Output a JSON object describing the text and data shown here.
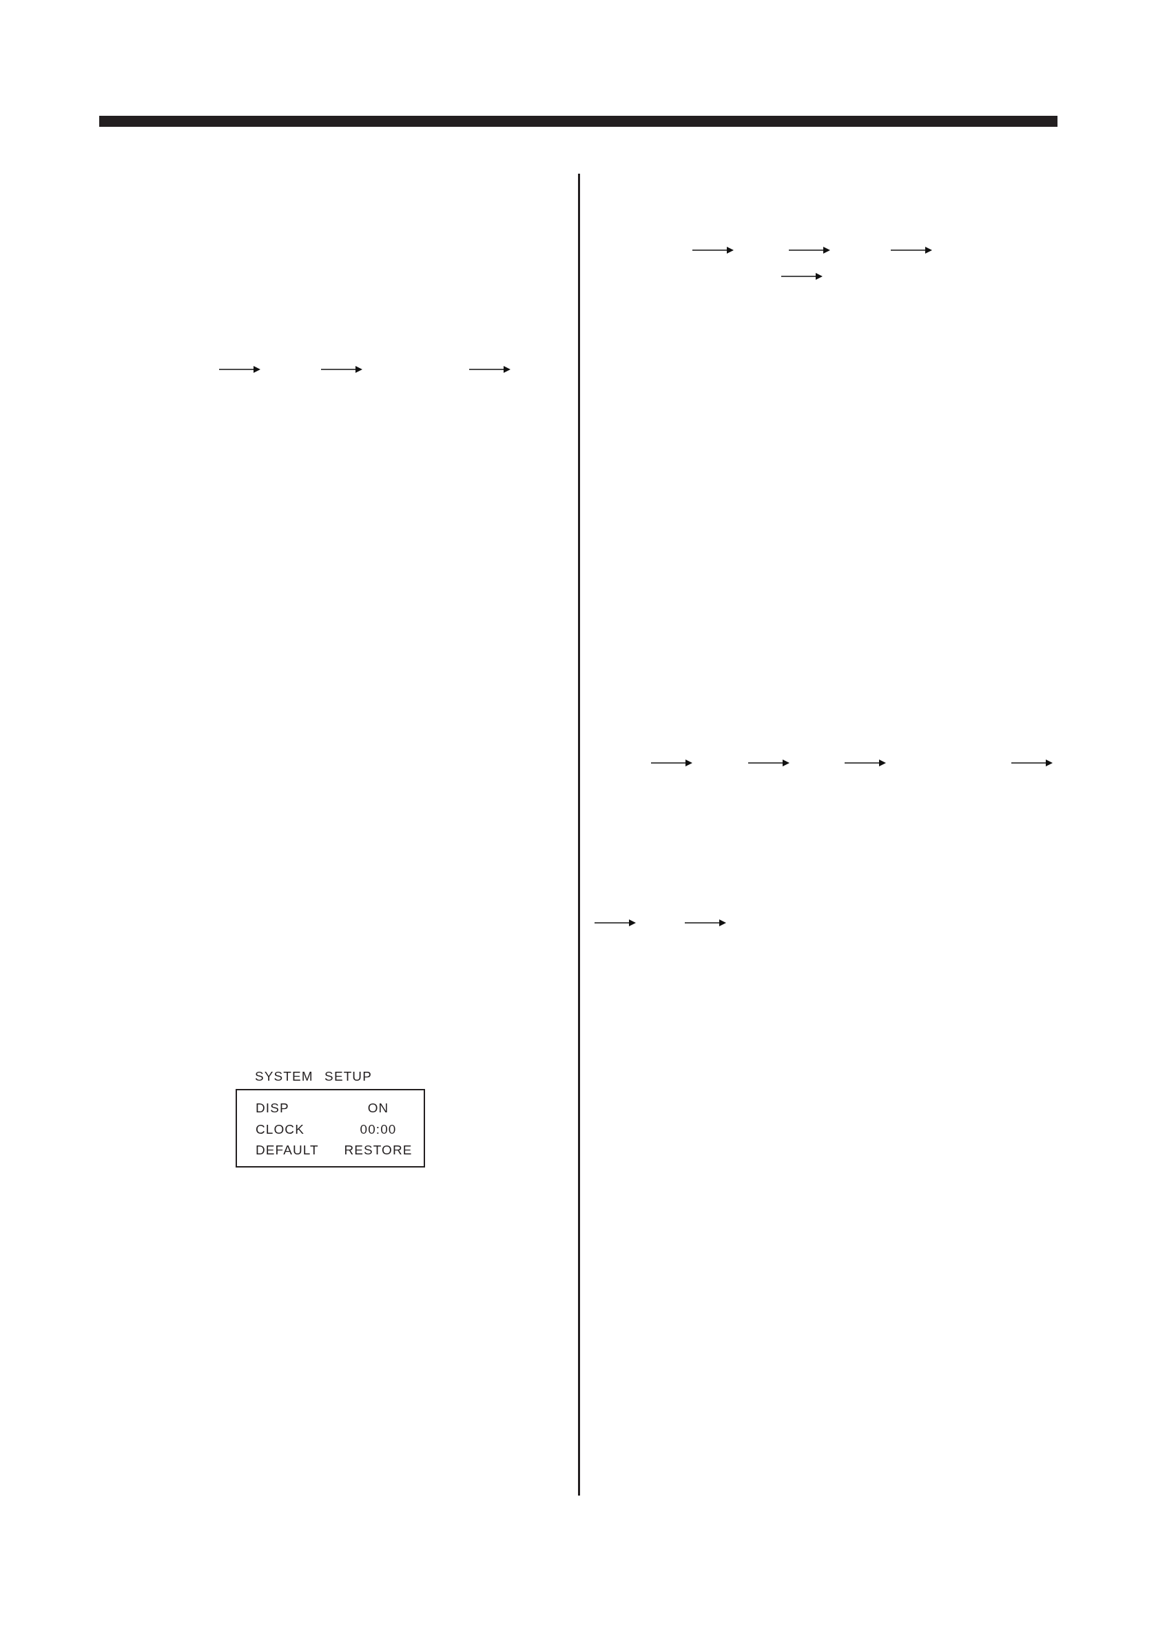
{
  "setup_menu": {
    "title": "SYSTEM SETUP",
    "rows": [
      {
        "label": "DISP",
        "value": "ON"
      },
      {
        "label": "CLOCK",
        "value": "00:00"
      },
      {
        "label": "DEFAULT",
        "value": "RESTORE"
      }
    ]
  }
}
